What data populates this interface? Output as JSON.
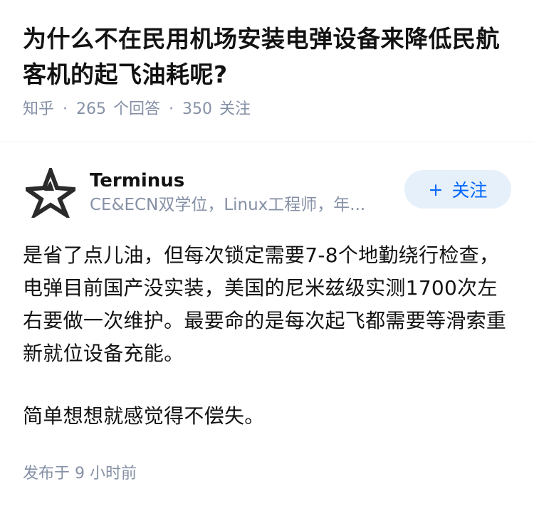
{
  "question": {
    "title": "为什么不在民用机场安装电弹设备来降低民航客机的起飞油耗呢?",
    "source": "知乎",
    "answers_count": "265",
    "answers_label": "个回答",
    "followers_count": "350",
    "followers_label": "关注",
    "separator": "·"
  },
  "answer": {
    "author_name": "Terminus",
    "author_bio": "CE&ECN双学位，Linux工程师，年...",
    "avatar_icon": "star-outline-icon",
    "follow_button": {
      "plus": "+",
      "label": "关注"
    },
    "paragraphs": [
      "是省了点儿油，但每次锁定需要7-8个地勤绕行检查，电弹目前国产没实装，美国的尼米兹级实测1700次左右要做一次维护。最要命的是每次起飞都需要等滑索重新就位设备充能。",
      "简单想想就感觉得不偿失。"
    ],
    "published": "发布于 9 小时前"
  },
  "colors": {
    "text": "#121212",
    "meta": "#8590a6",
    "accent": "#0066ff",
    "button_bg": "#e6f0fa"
  }
}
